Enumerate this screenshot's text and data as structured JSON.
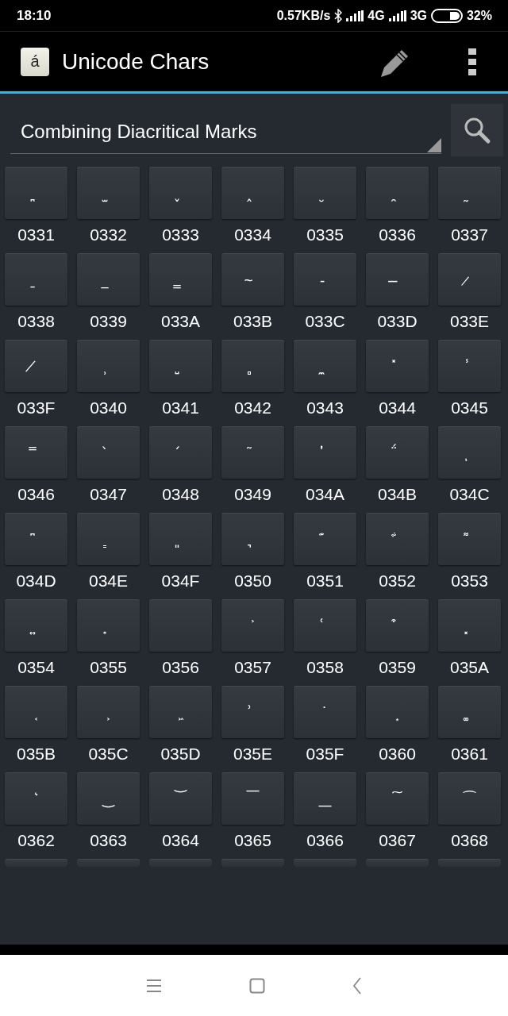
{
  "status_bar": {
    "time": "18:10",
    "speed": "0.57KB/s",
    "network_1": "4G",
    "network_2": "3G",
    "battery": "32%"
  },
  "app_bar": {
    "title": "Unicode Chars",
    "logo_letter": "á"
  },
  "block_selector": {
    "value": "Combining Diacritical Marks"
  },
  "tiles": [
    {
      "glyph": "̪",
      "code": "0331"
    },
    {
      "glyph": "̫",
      "code": "0332"
    },
    {
      "glyph": "̬",
      "code": "0333"
    },
    {
      "glyph": "̭",
      "code": "0334"
    },
    {
      "glyph": "̮",
      "code": "0335"
    },
    {
      "glyph": "̯",
      "code": "0336"
    },
    {
      "glyph": "̰",
      "code": "0337"
    },
    {
      "glyph": "̱",
      "code": "0338"
    },
    {
      "glyph": "̲",
      "code": "0339"
    },
    {
      "glyph": "̳",
      "code": "033A"
    },
    {
      "glyph": "̴",
      "code": "033B"
    },
    {
      "glyph": "̵",
      "code": "033C"
    },
    {
      "glyph": "̶",
      "code": "033D"
    },
    {
      "glyph": "̷",
      "code": "033E"
    },
    {
      "glyph": "̸",
      "code": "033F"
    },
    {
      "glyph": "̹",
      "code": "0340"
    },
    {
      "glyph": "̺",
      "code": "0341"
    },
    {
      "glyph": "̻",
      "code": "0342"
    },
    {
      "glyph": "̼",
      "code": "0343"
    },
    {
      "glyph": "̽",
      "code": "0344"
    },
    {
      "glyph": "̾",
      "code": "0345"
    },
    {
      "glyph": "̿",
      "code": "0346"
    },
    {
      "glyph": "̀",
      "code": "0347"
    },
    {
      "glyph": "́",
      "code": "0348"
    },
    {
      "glyph": "͂",
      "code": "0349"
    },
    {
      "glyph": "̓",
      "code": "034A"
    },
    {
      "glyph": "̈́",
      "code": "034B"
    },
    {
      "glyph": "ͅ",
      "code": "034C"
    },
    {
      "glyph": "͆",
      "code": "034D"
    },
    {
      "glyph": "͇",
      "code": "034E"
    },
    {
      "glyph": "͈",
      "code": "034F"
    },
    {
      "glyph": "͉",
      "code": "0350"
    },
    {
      "glyph": "͊",
      "code": "0351"
    },
    {
      "glyph": "͋",
      "code": "0352"
    },
    {
      "glyph": "͌",
      "code": "0353"
    },
    {
      "glyph": "͍",
      "code": "0354"
    },
    {
      "glyph": "͎",
      "code": "0355"
    },
    {
      "code": "0356"
    },
    {
      "glyph": "͐",
      "code": "0357"
    },
    {
      "glyph": "͑",
      "code": "0358"
    },
    {
      "glyph": "͒",
      "code": "0359"
    },
    {
      "glyph": "͓",
      "code": "035A"
    },
    {
      "glyph": "͔",
      "code": "035B"
    },
    {
      "glyph": "͕",
      "code": "035C"
    },
    {
      "glyph": "͖",
      "code": "035D"
    },
    {
      "glyph": "͗",
      "code": "035E"
    },
    {
      "glyph": "͘",
      "code": "035F"
    },
    {
      "glyph": "͙",
      "code": "0360"
    },
    {
      "glyph": "͚",
      "code": "0361"
    },
    {
      "glyph": "͛",
      "code": "0362"
    },
    {
      "glyph": "͜",
      "code": "0363"
    },
    {
      "glyph": "͝",
      "code": "0364"
    },
    {
      "glyph": "͞",
      "code": "0365"
    },
    {
      "glyph": "͟",
      "code": "0366"
    },
    {
      "glyph": "͠",
      "code": "0367"
    },
    {
      "glyph": "͡",
      "code": "0368"
    }
  ]
}
